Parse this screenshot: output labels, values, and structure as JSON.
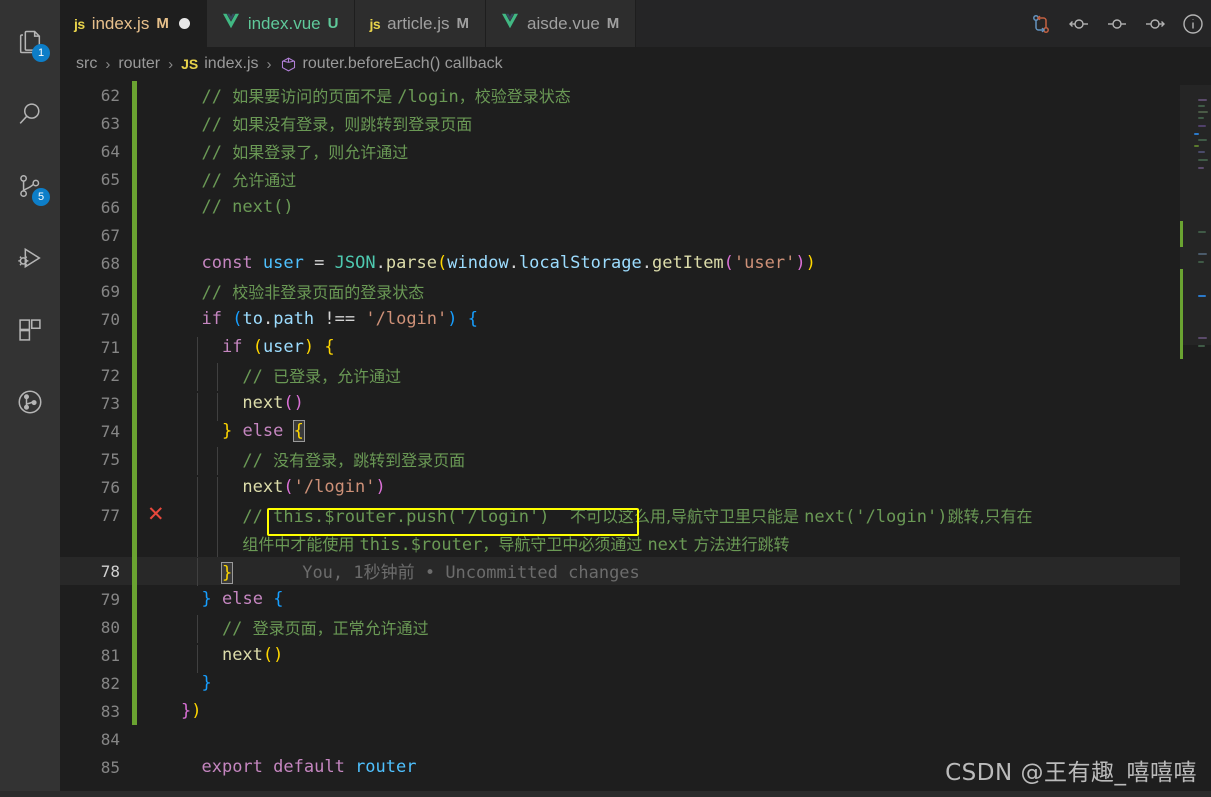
{
  "activity_bar": {
    "items": [
      {
        "name": "explorer",
        "icon": "files-icon",
        "badge": "1"
      },
      {
        "name": "search",
        "icon": "search-icon",
        "badge": ""
      },
      {
        "name": "source-control",
        "icon": "source-control-icon",
        "badge": "5"
      },
      {
        "name": "run-and-debug",
        "icon": "run-debug-icon",
        "badge": ""
      },
      {
        "name": "extensions",
        "icon": "extensions-icon",
        "badge": ""
      },
      {
        "name": "git-graph",
        "icon": "git-graph-icon",
        "badge": ""
      }
    ]
  },
  "tabs": [
    {
      "icon": "js-file-icon",
      "icon_kind": "js",
      "name": "index.js",
      "status": "M",
      "active": true,
      "dirty": true
    },
    {
      "icon": "vue-file-icon",
      "icon_kind": "vue",
      "name": "index.vue",
      "status": "U",
      "active": false,
      "dirty": false
    },
    {
      "icon": "js-file-icon",
      "icon_kind": "js",
      "name": "article.js",
      "status": "M",
      "active": false,
      "dirty": false
    },
    {
      "icon": "vue-file-icon",
      "icon_kind": "vue",
      "name": "aisde.vue",
      "status": "M",
      "active": false,
      "dirty": false
    }
  ],
  "tab_actions": [
    {
      "name": "split-editor-compare-icon",
      "label": ""
    },
    {
      "name": "go-back-icon",
      "label": ""
    },
    {
      "name": "go-to-icon",
      "label": ""
    },
    {
      "name": "go-forward-icon",
      "label": ""
    },
    {
      "name": "more-info-icon",
      "label": ""
    }
  ],
  "breadcrumb": {
    "items": [
      "src",
      "router",
      "index.js",
      "router.beforeEach() callback"
    ],
    "separator": "›",
    "file_icon_label": "JS",
    "symbol_icon": "symbol-method-icon"
  },
  "editor": {
    "first_line": 62,
    "active_line": 78,
    "error_line": 77,
    "blame_text": "You, 1秒钟前 • Uncommitted changes",
    "lines": [
      {
        "n": 62,
        "text": "  // 如果要访问的页面不是 /login，校验登录状态"
      },
      {
        "n": 63,
        "text": "  // 如果没有登录，则跳转到登录页面"
      },
      {
        "n": 64,
        "text": "  // 如果登录了，则允许通过"
      },
      {
        "n": 65,
        "text": "  // 允许通过"
      },
      {
        "n": 66,
        "text": "  // next()"
      },
      {
        "n": 67,
        "text": ""
      },
      {
        "n": 68,
        "text": "  const user = JSON.parse(window.localStorage.getItem('user'))"
      },
      {
        "n": 69,
        "text": "  // 校验非登录页面的登录状态"
      },
      {
        "n": 70,
        "text": "  if (to.path !== '/login') {"
      },
      {
        "n": 71,
        "text": "    if (user) {"
      },
      {
        "n": 72,
        "text": "      // 已登录，允许通过"
      },
      {
        "n": 73,
        "text": "      next()"
      },
      {
        "n": 74,
        "text": "    } else {"
      },
      {
        "n": 75,
        "text": "      // 没有登录，跳转到登录页面"
      },
      {
        "n": 76,
        "text": "      next('/login')"
      },
      {
        "n": 77,
        "text": "      // this.$router.push('/login')  不可以这么用,导航守卫里只能是 next('/login')跳转,只有在组件中才能使用 this.$router，导航守卫中必须通过 next 方法进行跳转"
      },
      {
        "n": 78,
        "text": "    }"
      },
      {
        "n": 79,
        "text": "  } else {"
      },
      {
        "n": 80,
        "text": "    // 登录页面，正常允许通过"
      },
      {
        "n": 81,
        "text": "    next()"
      },
      {
        "n": 82,
        "text": "  }"
      },
      {
        "n": 83,
        "text": "})"
      },
      {
        "n": 84,
        "text": ""
      },
      {
        "n": 85,
        "text": "export default router"
      }
    ],
    "line77_comment": "// this.$router.push('/login')",
    "line77_note_a": "不可以这么用,导航守卫里只能是",
    "line77_note_code": "next('/login')",
    "line77_note_b": "跳转,只有在",
    "line77_wrap_a": "组件中才能使用",
    "line77_wrap_code1": "this.$router",
    "line77_wrap_b": "，导航守卫中必须通过",
    "line77_wrap_code2": "next",
    "line77_wrap_c": "方法进行跳转"
  },
  "watermark": "CSDN @王有趣_嘻嘻嘻",
  "colors": {
    "background": "#1e1e1e",
    "activity_bar": "#333333",
    "tab_inactive": "#2d2d2d",
    "badge": "#0d7ec8",
    "comment": "#6a9955",
    "keyword": "#c586c0",
    "variable": "#9cdcfe",
    "string": "#ce9178",
    "function": "#dcdcaa",
    "error": "#e8483c",
    "highlight_box": "#ffff00",
    "git_modified": "#6aa331"
  }
}
